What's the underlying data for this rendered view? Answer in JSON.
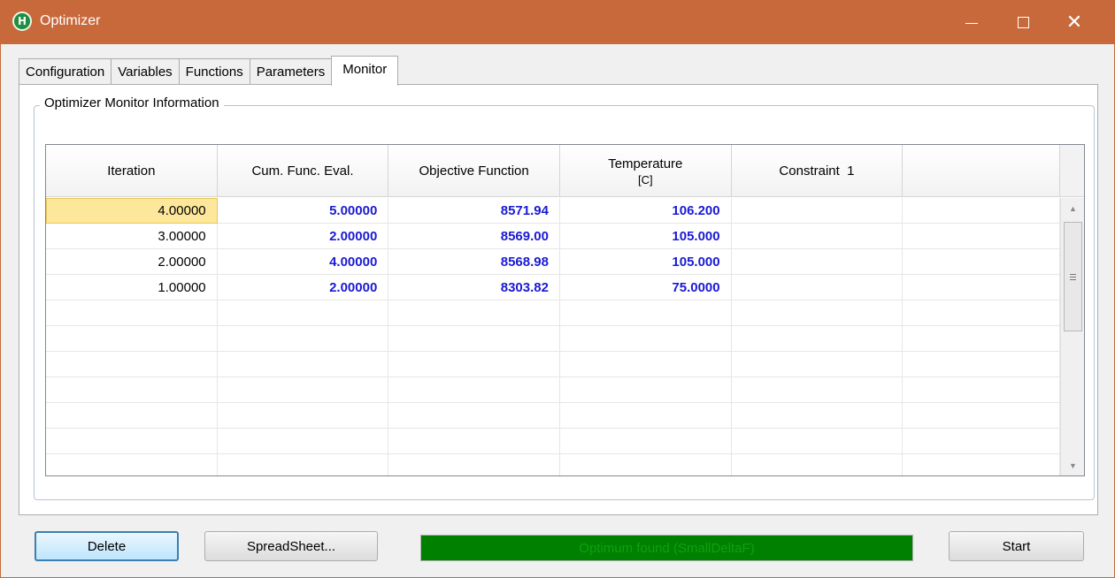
{
  "window": {
    "title": "Optimizer",
    "icon": "app-logo-icon",
    "accent_color": "#c8693b"
  },
  "tabs": [
    {
      "label": "Configuration",
      "active": false
    },
    {
      "label": "Variables",
      "active": false
    },
    {
      "label": "Functions",
      "active": false
    },
    {
      "label": "Parameters",
      "active": false
    },
    {
      "label": "Monitor",
      "active": true
    }
  ],
  "group": {
    "label": "Optimizer Monitor Information"
  },
  "grid": {
    "columns": [
      {
        "label": "Iteration",
        "sub": ""
      },
      {
        "label": "Cum. Func. Eval.",
        "sub": ""
      },
      {
        "label": "Objective Function",
        "sub": ""
      },
      {
        "label": "Temperature",
        "sub": "[C]"
      },
      {
        "label": "Constraint  1",
        "sub": ""
      },
      {
        "label": "",
        "sub": ""
      }
    ],
    "rows": [
      [
        "4.00000",
        "5.00000",
        "8571.94",
        "106.200",
        "",
        ""
      ],
      [
        "3.00000",
        "2.00000",
        "8569.00",
        "105.000",
        "",
        ""
      ],
      [
        "2.00000",
        "4.00000",
        "8568.98",
        "105.000",
        "",
        ""
      ],
      [
        "1.00000",
        "2.00000",
        "8303.82",
        "75.0000",
        "",
        ""
      ]
    ],
    "value_color": "#1a1ad4",
    "selected_color": "#fde79a"
  },
  "buttons": {
    "delete": "Delete",
    "spreadsheet": "SpreadSheet...",
    "start": "Start"
  },
  "status": {
    "text": "Optimum found (SmallDeltaF)",
    "color": "#008000"
  }
}
